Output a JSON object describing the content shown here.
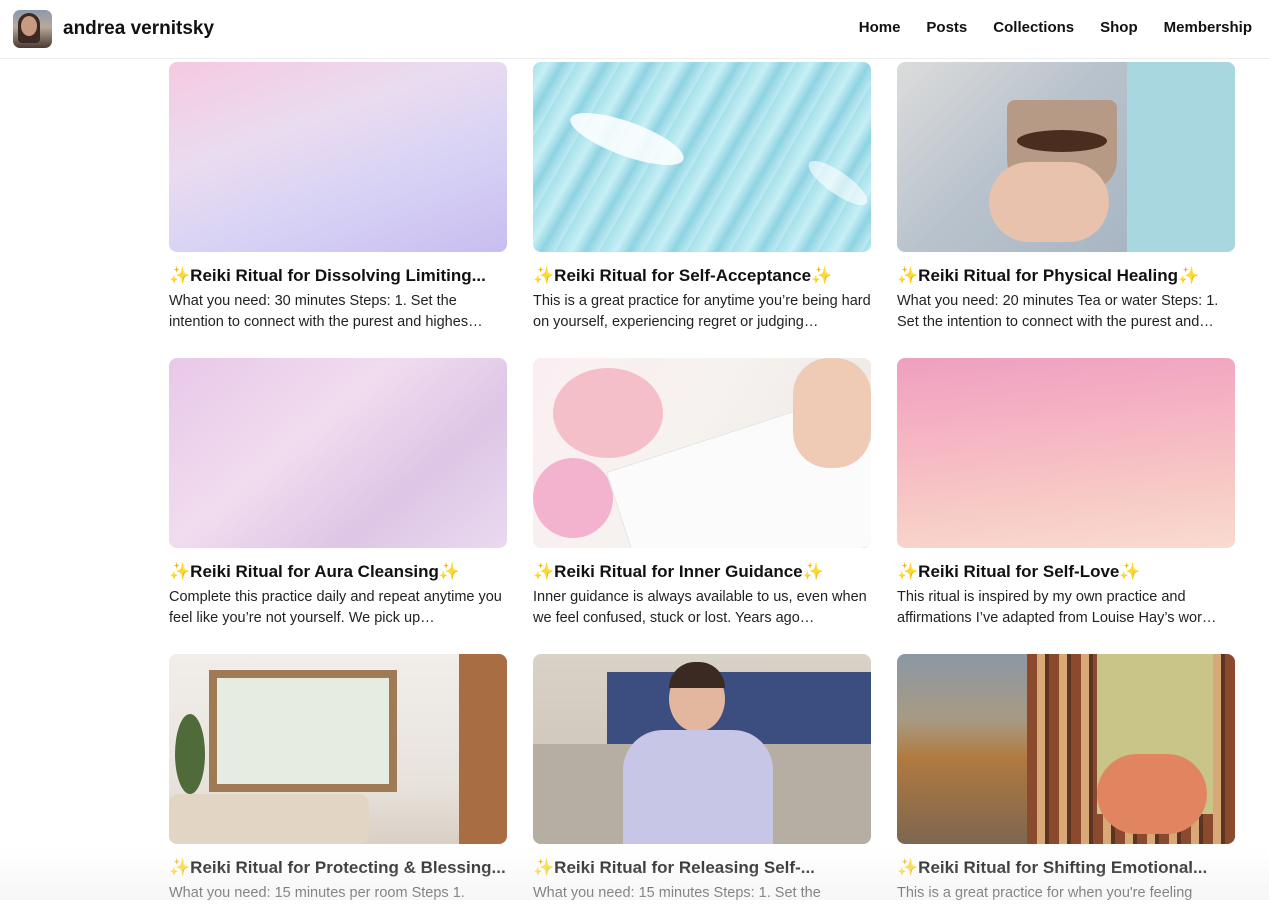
{
  "header": {
    "site_name": "andrea vernitsky",
    "nav": [
      "Home",
      "Posts",
      "Collections",
      "Shop",
      "Membership"
    ]
  },
  "accent_spark_color": "#e8b830",
  "posts": [
    {
      "spark": "✨",
      "title": "Reiki Ritual for Dissolving Limiting...",
      "excerpt": "What you need: 30 minutes Steps: 1. Set the intention to connect with the purest and highes…",
      "image": "pastel-gradient"
    },
    {
      "spark": "✨",
      "title": "Reiki Ritual for Self-Acceptance✨",
      "excerpt": "This is a great practice for anytime you’re being hard on yourself, experiencing regret or judging…",
      "image": "feather-on-water"
    },
    {
      "spark": "✨",
      "title": "Reiki Ritual for Physical Healing✨",
      "excerpt": "What you need: 20 minutes Tea or water Steps: 1. Set the intention to connect with the purest and…",
      "image": "hands-holding-tea"
    },
    {
      "spark": "✨",
      "title": "Reiki Ritual for Aura Cleansing✨",
      "excerpt": "Complete this practice daily and repeat anytime you feel like you’re not yourself. We pick up…",
      "image": "pink-clouds"
    },
    {
      "spark": "✨",
      "title": "Reiki Ritual for Inner Guidance✨",
      "excerpt": "Inner guidance is always available to us, even when we feel confused, stuck or lost. Years ago…",
      "image": "journal-and-flowers"
    },
    {
      "spark": "✨",
      "title": "Reiki Ritual for Self-Love✨",
      "excerpt": "This ritual is inspired by my own practice and affirmations I’ve adapted from Louise Hay’s wor…",
      "image": "pink-sky"
    },
    {
      "spark": "✨",
      "title": "Reiki Ritual for Protecting & Blessing...",
      "excerpt": "What you need: 15 minutes per room Steps 1.",
      "image": "living-room"
    },
    {
      "spark": "✨",
      "title": "Reiki Ritual for Releasing Self-...",
      "excerpt": "What you need: 15 minutes Steps: 1. Set the",
      "image": "woman-meditating"
    },
    {
      "spark": "✨",
      "title": "Reiki Ritual for Shifting Emotional...",
      "excerpt": "This is a great practice for when you're feeling",
      "image": "hands-on-stomach"
    }
  ]
}
